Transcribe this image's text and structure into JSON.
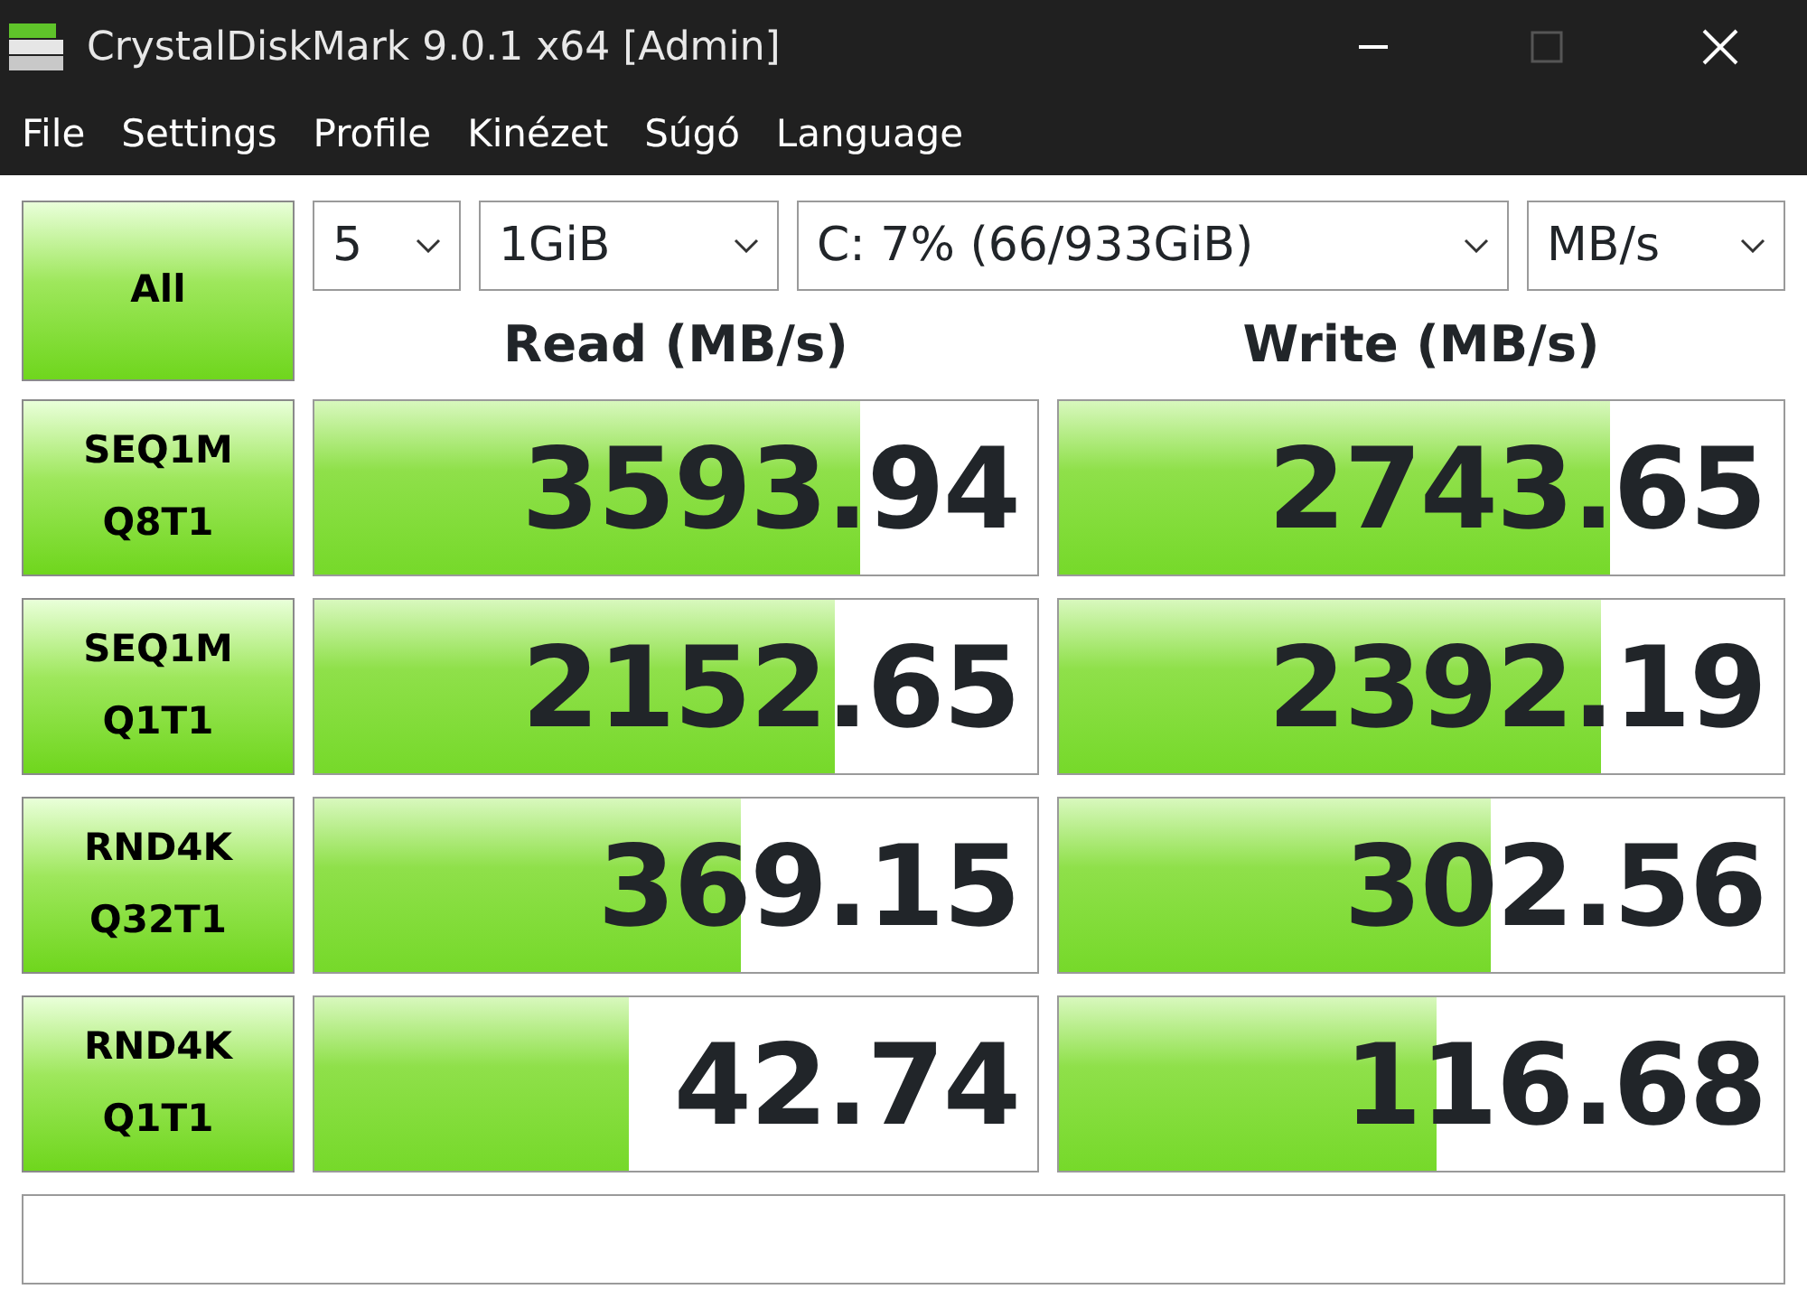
{
  "window": {
    "title": "CrystalDiskMark 9.0.1 x64 [Admin]"
  },
  "menu": [
    "File",
    "Settings",
    "Profile",
    "Kinézet",
    "Súgó",
    "Language"
  ],
  "all_button": "All",
  "selects": [
    {
      "value": "5"
    },
    {
      "value": "1GiB"
    },
    {
      "value": "C: 7% (66/933GiB)"
    },
    {
      "value": "MB/s"
    }
  ],
  "columns": [
    "Read (MB/s)",
    "Write (MB/s)"
  ],
  "rows": [
    {
      "label": [
        "SEQ1M",
        "Q8T1"
      ],
      "read": {
        "value": "3593.94",
        "level": 0.756
      },
      "write": {
        "value": "2743.65",
        "level": 0.76
      }
    },
    {
      "label": [
        "SEQ1M",
        "Q1T1"
      ],
      "read": {
        "value": "2152.65",
        "level": 0.72
      },
      "write": {
        "value": "2392.19",
        "level": 0.748
      }
    },
    {
      "label": [
        "RND4K",
        "Q32T1"
      ],
      "read": {
        "value": "369.15",
        "level": 0.59
      },
      "write": {
        "value": "302.56",
        "level": 0.595
      }
    },
    {
      "label": [
        "RND4K",
        "Q1T1"
      ],
      "read": {
        "value": "42.74",
        "level": 0.435
      },
      "write": {
        "value": "116.68",
        "level": 0.52
      }
    }
  ]
}
